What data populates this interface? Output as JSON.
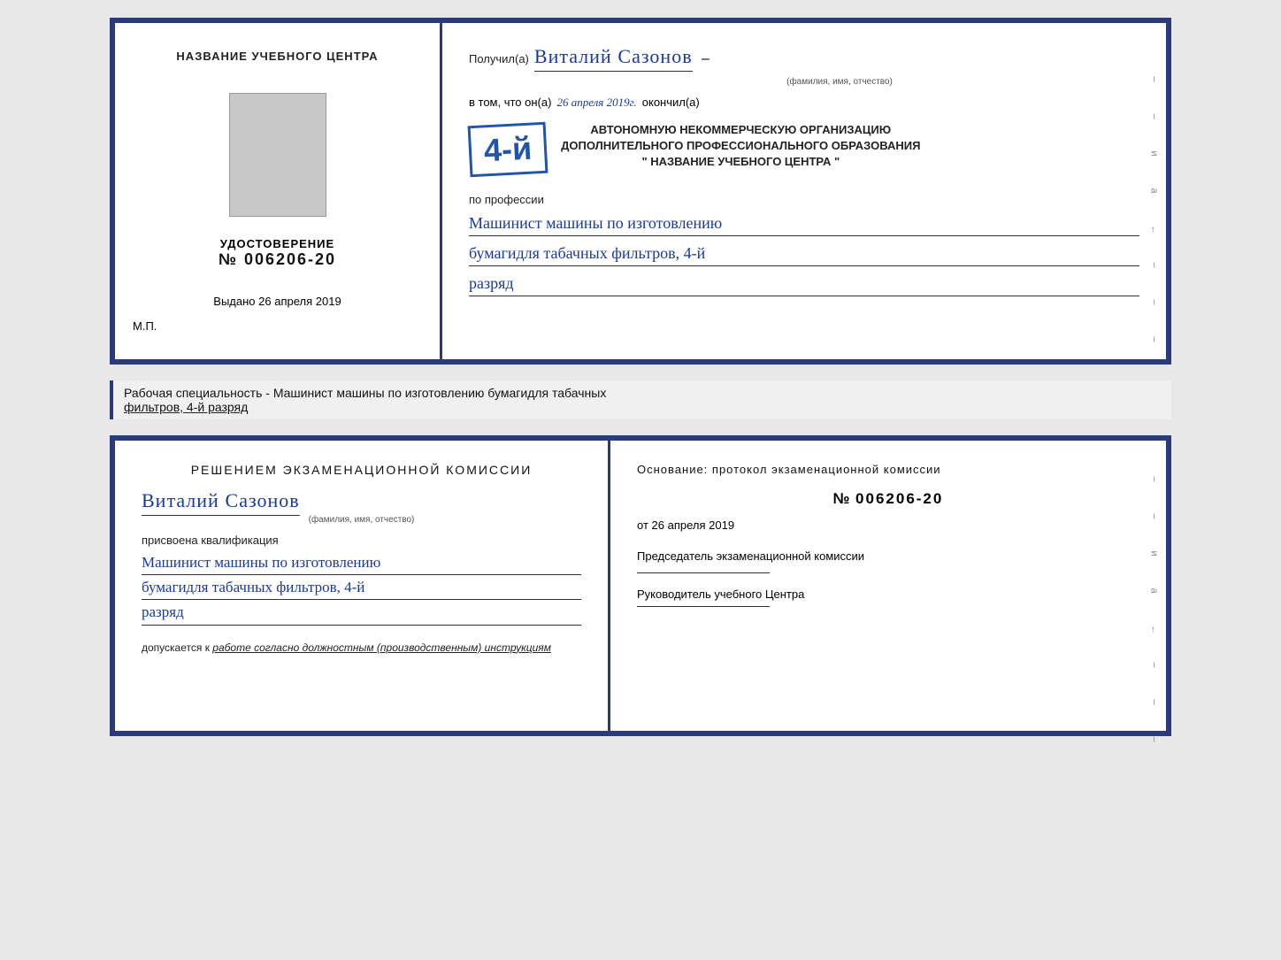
{
  "top_diploma": {
    "left": {
      "title": "НАЗВАНИЕ УЧЕБНОГО ЦЕНТРА",
      "cert_label": "УДОСТОВЕРЕНИЕ",
      "cert_number": "№ 006206-20",
      "issued_label": "Выдано",
      "issued_date": "26 апреля 2019",
      "mp_label": "М.П."
    },
    "right": {
      "received_label": "Получил(а)",
      "name": "Виталий Сазонов",
      "name_subtitle": "(фамилия, имя, отчество)",
      "vtom_label": "в том, что он(а)",
      "vtom_date": "26 апреля 2019г.",
      "finished_label": "окончил(а)",
      "stamp_number": "4-й",
      "org_line1": "АВТОНОМНУЮ НЕКОММЕРЧЕСКУЮ ОРГАНИЗАЦИЮ",
      "org_line2": "ДОПОЛНИТЕЛЬНОГО ПРОФЕССИОНАЛЬНОГО ОБРАЗОВАНИЯ",
      "org_line3": "\" НАЗВАНИЕ УЧЕБНОГО ЦЕНТРА \"",
      "profession_label": "по профессии",
      "profession_line1": "Машинист машины по изготовлению",
      "profession_line2": "бумагидля табачных фильтров, 4-й",
      "profession_line3": "разряд"
    }
  },
  "caption": {
    "prefix": "Рабочая специальность - Машинист машины по изготовлению бумагидля табачных",
    "underline": "фильтров, 4-й разряд"
  },
  "bottom_cert": {
    "left": {
      "heading": "Решением экзаменационной комиссии",
      "name": "Виталий Сазонов",
      "name_subtitle": "(фамилия, имя, отчество)",
      "assigned_label": "присвоена квалификация",
      "profession_line1": "Машинист машины по изготовлению",
      "profession_line2": "бумагидля табачных фильтров, 4-й",
      "profession_line3": "разряд",
      "admission_prefix": "допускается к",
      "admission_italic": "работе согласно должностным (производственным) инструкциям"
    },
    "right": {
      "heading": "Основание: протокол экзаменационной комиссии",
      "number_prefix": "№",
      "number_value": "006206-20",
      "from_prefix": "от",
      "from_date": "26 апреля 2019",
      "chairman_label": "Председатель экзаменационной комиссии",
      "head_label": "Руководитель учебного Центра"
    }
  },
  "side_marks": [
    "–",
    "–",
    "и",
    "а",
    "←",
    "–",
    "–",
    "–"
  ],
  "colors": {
    "border": "#2a3a7a",
    "handwritten": "#1a3a9a",
    "stamp": "#2255aa"
  }
}
